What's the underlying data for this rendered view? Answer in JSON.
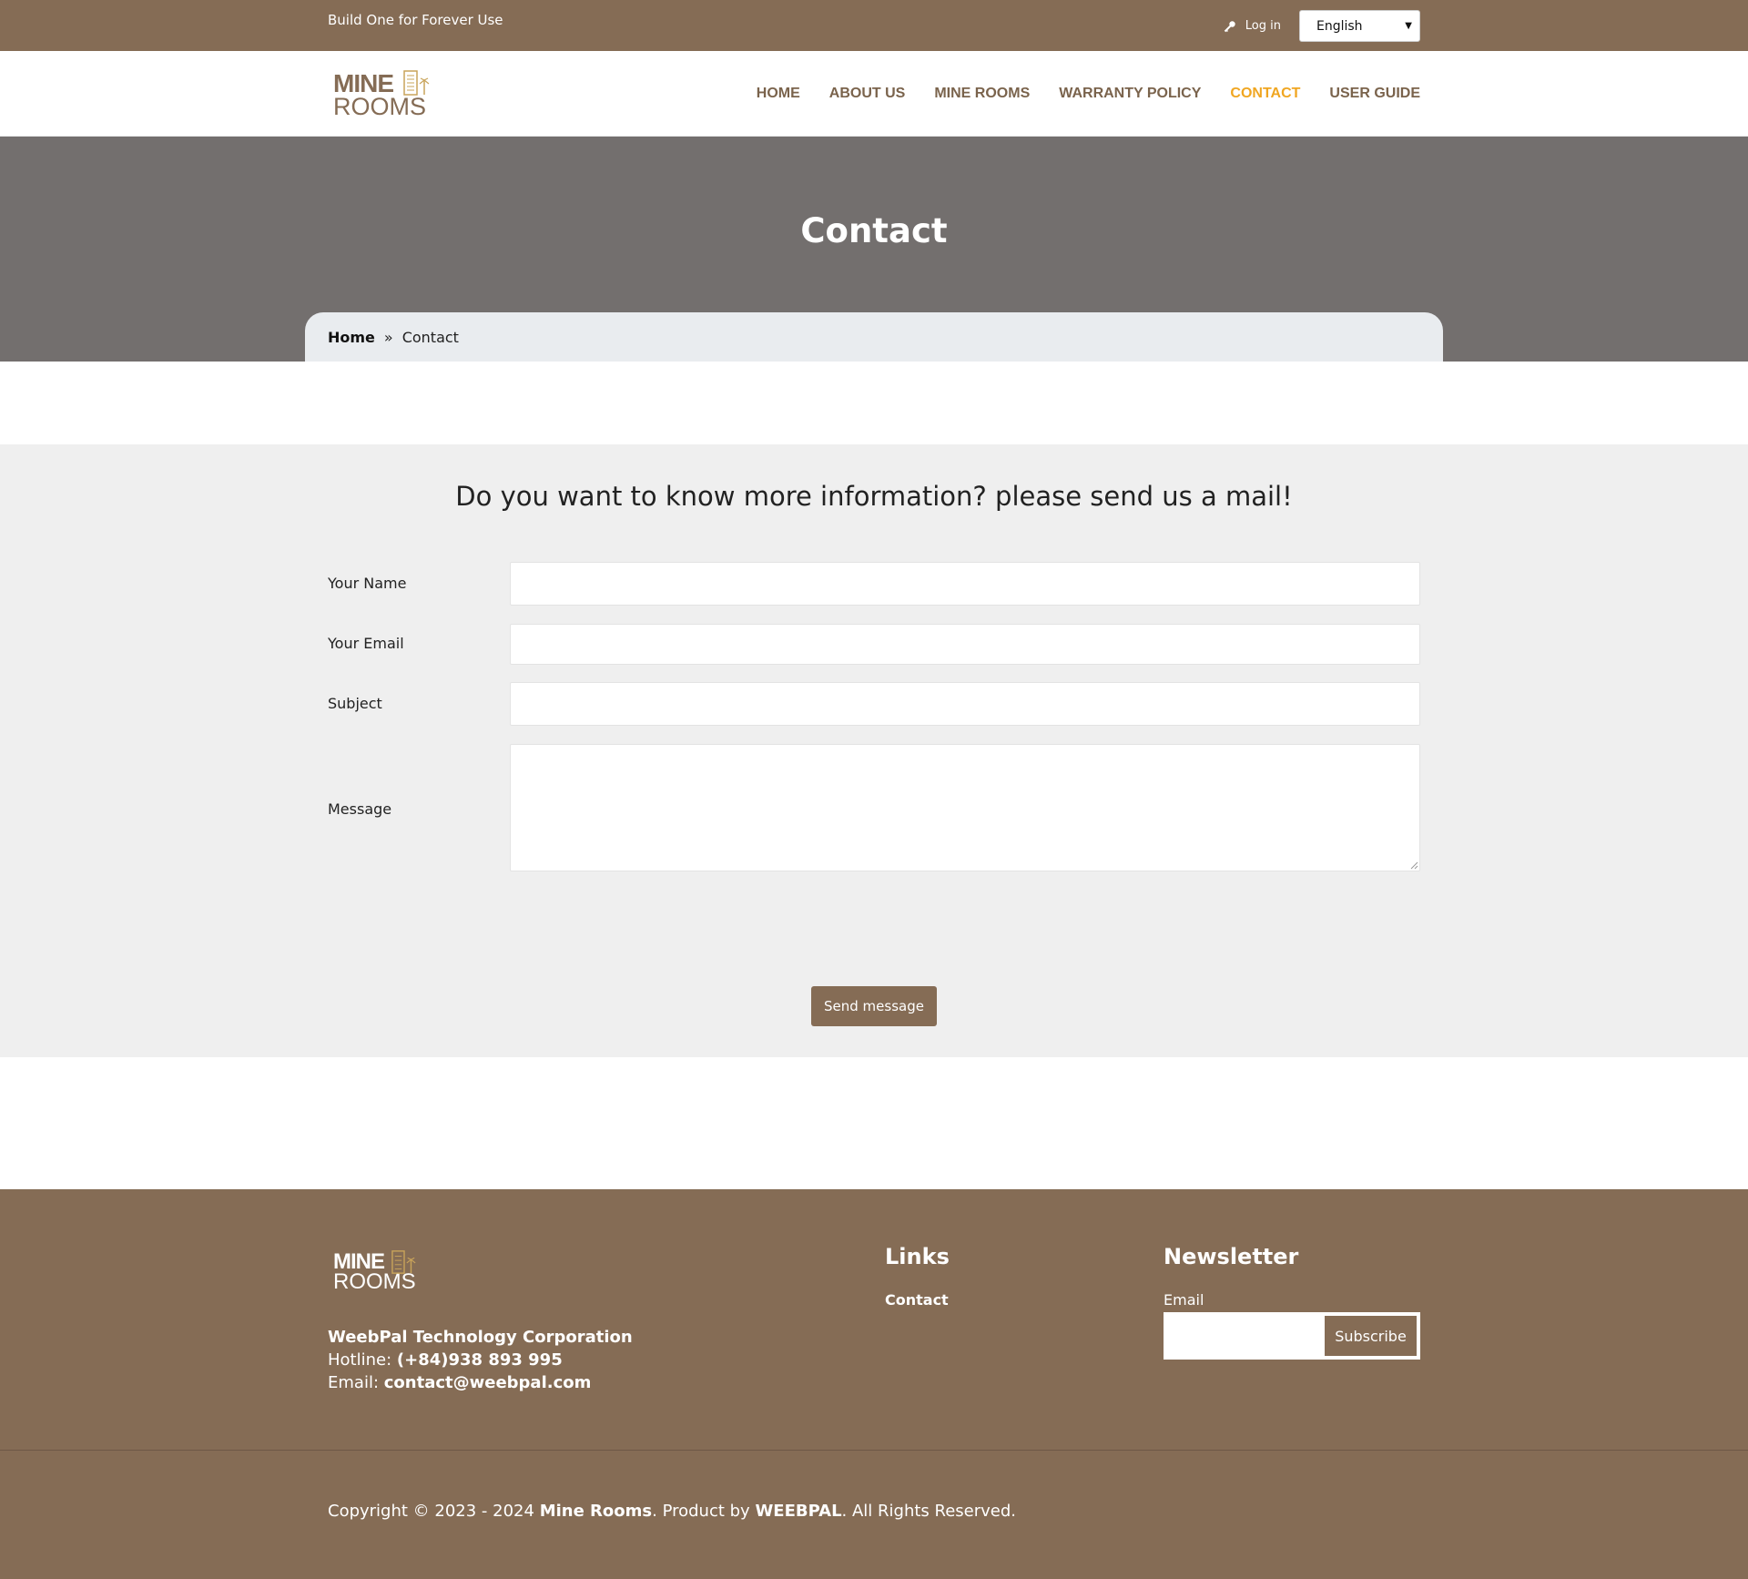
{
  "topbar": {
    "tagline": "Build One for Forever Use",
    "login_label": "Log in",
    "language_selected": "English"
  },
  "logo": {
    "line1": "MINE",
    "line2": "ROOMS"
  },
  "nav": {
    "items": [
      {
        "label": "HOME"
      },
      {
        "label": "ABOUT US"
      },
      {
        "label": "MINE ROOMS"
      },
      {
        "label": "WARRANTY POLICY"
      },
      {
        "label": "CONTACT"
      },
      {
        "label": "USER GUIDE"
      }
    ],
    "active_index": 4
  },
  "hero": {
    "title": "Contact"
  },
  "breadcrumb": {
    "home": "Home",
    "separator": "»",
    "current": "Contact"
  },
  "form": {
    "heading": "Do you want to know more information? please send us a mail!",
    "labels": {
      "name": "Your Name",
      "email": "Your Email",
      "subject": "Subject",
      "message": "Message"
    },
    "send_label": "Send message"
  },
  "footer": {
    "logo": {
      "line1": "MINE",
      "line2": "ROOMS"
    },
    "company_name": "WeebPal Technology Corporation",
    "hotline_label": "Hotline: ",
    "hotline_value": "(+84)938 893 995",
    "email_label": "Email: ",
    "email_value": "contact@weebpal.com",
    "links_title": "Links",
    "links": [
      {
        "label": "Contact"
      }
    ],
    "newsletter_title": "Newsletter",
    "newsletter_email_label": "Email",
    "subscribe_label": "Subscribe",
    "copyright_prefix": "Copyright © 2023 - 2024 ",
    "copyright_brand": "Mine Rooms",
    "copyright_mid": ". Product by ",
    "copyright_company": "WEEBPAL",
    "copyright_suffix": ". All Rights Reserved."
  },
  "colors": {
    "brand_brown": "#856c55",
    "nav_active": "#f0a621",
    "hero_gray": "#736f6e",
    "form_bg": "#efefef"
  }
}
